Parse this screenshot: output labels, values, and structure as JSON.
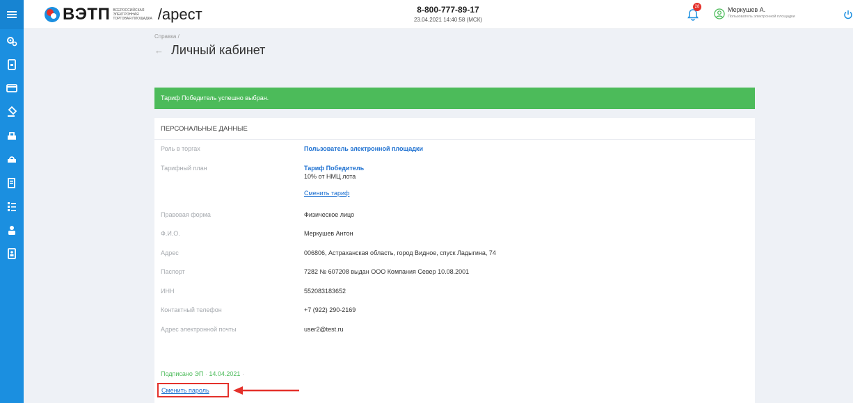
{
  "header": {
    "logo_main": "ВЭТП",
    "logo_small": [
      "ВСЕРОССИЙСКАЯ",
      "ЭЛЕКТРОННАЯ",
      "ТОРГОВАЯ ПЛОЩАДКА"
    ],
    "logo_suffix": "/арест",
    "phone": "8-800-777-89-17",
    "datetime": "23.04.2021 14:40:58 (МСК)",
    "notification_count": "28",
    "user_name": "Меркушев А.",
    "user_role": "Пользователь электронной площадки"
  },
  "breadcrumb": "Справка /",
  "page_title": "Личный кабинет",
  "alert": "Тариф Победитель успешно выбран.",
  "card": {
    "title": "ПЕРСОНАЛЬНЫЕ ДАННЫЕ",
    "role_label": "Роль в торгах",
    "role_value": "Пользователь электронной площадки",
    "tariff_label": "Тарифный план",
    "tariff_value": "Тариф Победитель",
    "tariff_sub": "10% от НМЦ лота",
    "change_tariff": "Сменить тариф",
    "rows": [
      {
        "label": "Правовая форма",
        "value": "Физическое лицо"
      },
      {
        "label": "Ф.И.О.",
        "value": "Меркушев Антон"
      },
      {
        "label": "Адрес",
        "value": "006806, Астраханская область, город Видное, спуск Ладыгина, 74"
      },
      {
        "label": "Паспорт",
        "value": "7282 № 607208 выдан ООО Компания Север 10.08.2001"
      },
      {
        "label": "ИНН",
        "value": "552083183652"
      },
      {
        "label": "Контактный телефон",
        "value": "+7 (922) 290-2169"
      },
      {
        "label": "Адрес электронной почты",
        "value": "user2@test.ru"
      }
    ],
    "signed_text": "Подписано ЭП",
    "signed_date": "14.04.2021",
    "change_password": "Сменить пароль"
  },
  "colors": {
    "rail": "#1b8fe0",
    "alert_green": "#4cbb5a",
    "link_blue": "#1b6fd0",
    "highlight_red": "#e4312b"
  }
}
